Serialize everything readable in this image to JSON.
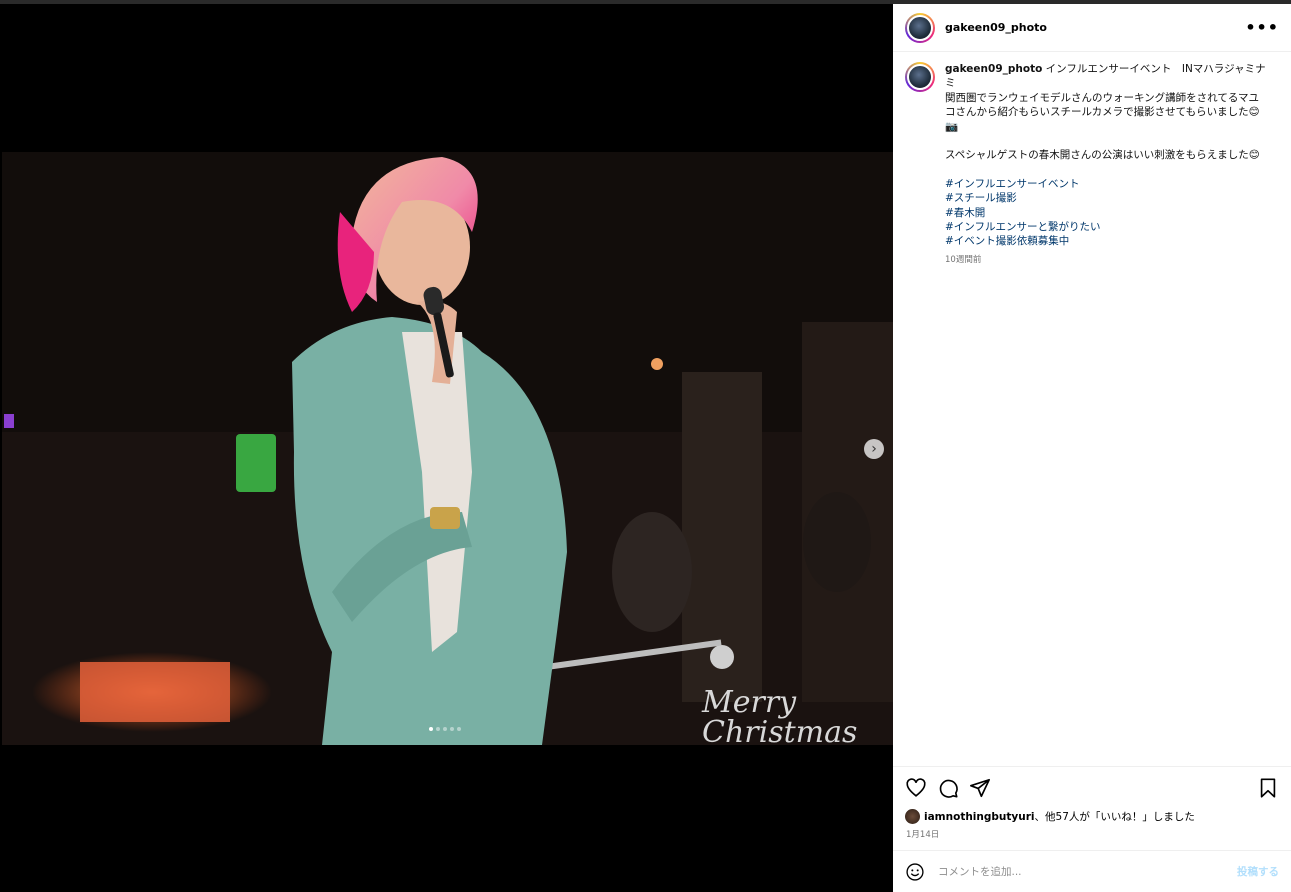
{
  "post": {
    "username": "gakeen09_photo",
    "caption_title": "インフルエンサーイベント　INマハラジャミナミ",
    "caption_lines": "関西圏でランウェイモデルさんのウォーキング講師をされてるマユコさんから紹介もらいスチールカメラで撮影させてもらいました😊📷\n\nスペシャルゲストの春木開さんの公演はいい刺激をもらえました😊",
    "hashtags": [
      "#インフルエンサーイベント",
      "#スチール撮影",
      "#春木開",
      "#インフルエンサーと繋がりたい",
      "#イベント撮影依頼募集中"
    ],
    "caption_time": "10週間前",
    "likes_user": "iamnothingbutyuri",
    "likes_text": "、他57人が「いいね！」しました",
    "date": "1月14日",
    "carousel": {
      "count": 5,
      "active": 0
    }
  },
  "comment": {
    "placeholder": "コメントを追加...",
    "post_label": "投稿する"
  },
  "icons": {
    "more": "more-options-icon",
    "next": "chevron-right-icon"
  },
  "colors": {
    "hashtag": "#00376b",
    "post_button": "#b2dffc",
    "meta": "#737373"
  }
}
